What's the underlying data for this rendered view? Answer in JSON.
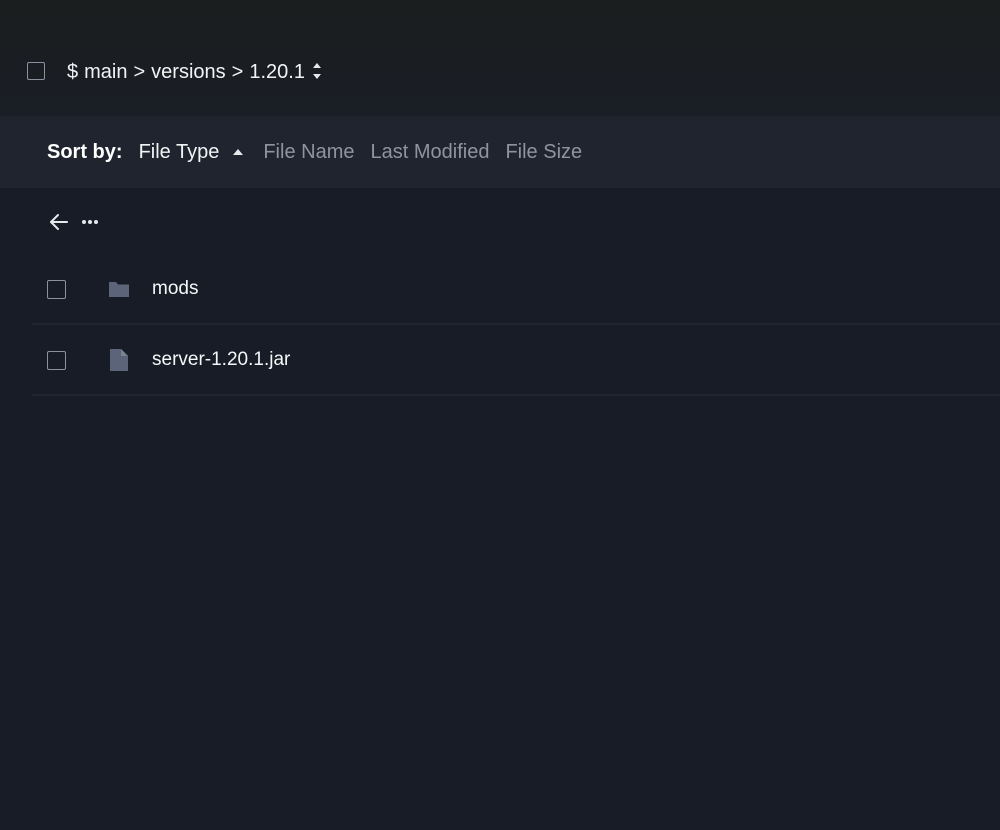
{
  "breadcrumb": {
    "prefix": "$",
    "parts": [
      "main",
      "versions",
      "1.20.1"
    ],
    "separator": ">"
  },
  "sort": {
    "label": "Sort by:",
    "options": [
      "File Type",
      "File Name",
      "Last Modified",
      "File Size"
    ],
    "active": "File Type",
    "direction": "ascending"
  },
  "toolbar": {
    "back_icon": "arrow-left-icon",
    "more_icon": "more-horizontal-icon"
  },
  "files": [
    {
      "name": "mods",
      "icon": "folder-icon"
    },
    {
      "name": "server-1.20.1.jar",
      "icon": "file-icon"
    }
  ],
  "colors": {
    "background": "#181c26",
    "sortbar": "#1f242f",
    "icon": "#5c6479",
    "text_muted": "#8f94a0"
  }
}
